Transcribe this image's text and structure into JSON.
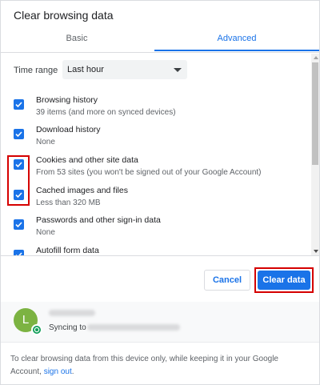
{
  "dialog": {
    "title": "Clear browsing data"
  },
  "tabs": [
    {
      "label": "Basic",
      "selected": false
    },
    {
      "label": "Advanced",
      "selected": true
    }
  ],
  "time_range": {
    "label": "Time range",
    "value": "Last hour"
  },
  "items": [
    {
      "title": "Browsing history",
      "subtitle": "39 items (and more on synced devices)",
      "checked": true
    },
    {
      "title": "Download history",
      "subtitle": "None",
      "checked": true
    },
    {
      "title": "Cookies and other site data",
      "subtitle": "From 53 sites (you won't be signed out of your Google Account)",
      "checked": true
    },
    {
      "title": "Cached images and files",
      "subtitle": "Less than 320 MB",
      "checked": true
    },
    {
      "title": "Passwords and other sign-in data",
      "subtitle": "None",
      "checked": true
    },
    {
      "title": "Autofill form data",
      "subtitle": "",
      "checked": true
    }
  ],
  "buttons": {
    "cancel": "Cancel",
    "clear": "Clear data"
  },
  "account": {
    "avatar_letter": "L",
    "syncing_prefix": "Syncing to"
  },
  "footnote": {
    "text": "To clear browsing data from this device only, while keeping it in your Google Account, ",
    "link": "sign out",
    "end": "."
  },
  "colors": {
    "accent": "#1a73e8",
    "highlight": "#d50000",
    "avatar": "#7cb342",
    "sync_badge": "#0f9d58"
  }
}
